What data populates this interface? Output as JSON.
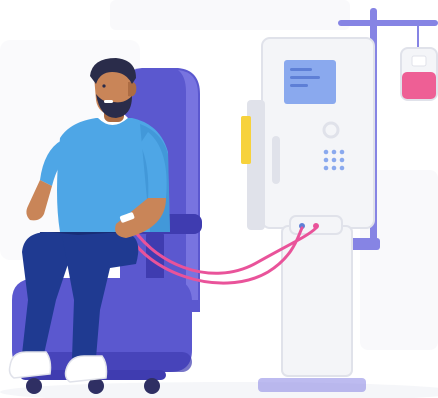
{
  "scene": {
    "subject": "patient-in-dialysis-chair",
    "colors": {
      "background": "#ffffff",
      "soft_gray": "#f1f2f6",
      "chair_main": "#5b58cf",
      "chair_dark": "#3f3cb0",
      "chair_light": "#7f7ce3",
      "shirt": "#4ea6e6",
      "shirt_shadow": "#3b8fd0",
      "jeans": "#1f3a91",
      "jeans_dark": "#182e76",
      "skin": "#c98558",
      "skin_dark": "#ad6c43",
      "hair": "#2a2c4a",
      "sneaker": "#ffffff",
      "machine_body": "#f4f5f8",
      "machine_edge": "#e0e2ea",
      "screen": "#8aa9ee",
      "screen_text": "#5e7fd6",
      "tube": "#e9539a",
      "indicator_yellow": "#f7d23c",
      "pole": "#8684e4",
      "bag_pink": "#ee5f95",
      "wheel": "#2f2f63"
    },
    "icons": [
      "dialysis-machine",
      "iv-pole",
      "iv-bag",
      "patient-chair",
      "tubing"
    ]
  }
}
